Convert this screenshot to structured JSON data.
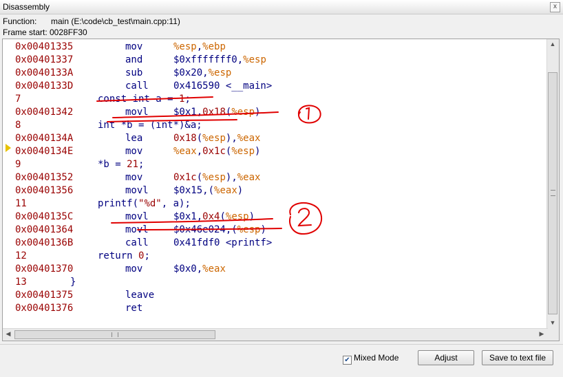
{
  "window": {
    "title": "Disassembly",
    "close_glyph": "x"
  },
  "info": {
    "function_label": "Function:",
    "function_value": "main (E:\\code\\cb_test\\main.cpp:11)",
    "frame_label": "Frame start: 0028FF30"
  },
  "lines": [
    {
      "kind": "asm",
      "addr": "0x00401335",
      "mnem": "mov",
      "ops": [
        [
          "%esp",
          "reg"
        ],
        [
          ",",
          "op"
        ],
        [
          "%ebp",
          "reg"
        ]
      ]
    },
    {
      "kind": "asm",
      "addr": "0x00401337",
      "mnem": "and",
      "ops": [
        [
          "$0xfffffff0",
          "op"
        ],
        [
          ",",
          "op"
        ],
        [
          "%esp",
          "reg"
        ]
      ]
    },
    {
      "kind": "asm",
      "addr": "0x0040133A",
      "mnem": "sub",
      "ops": [
        [
          "$0x20",
          "op"
        ],
        [
          ",",
          "op"
        ],
        [
          "%esp",
          "reg"
        ]
      ]
    },
    {
      "kind": "asm",
      "addr": "0x0040133D",
      "mnem": "call",
      "ops": [
        [
          "0x416590 <__main>",
          "op"
        ]
      ]
    },
    {
      "kind": "src",
      "num": "7",
      "parts": [
        [
          "const int a = ",
          "op"
        ],
        [
          "1",
          "num"
        ],
        [
          ";",
          "op"
        ]
      ]
    },
    {
      "kind": "asm",
      "addr": "0x00401342",
      "mnem": "movl",
      "ops": [
        [
          "$0x1",
          "op"
        ],
        [
          ",",
          "op"
        ],
        [
          "0x18",
          "num"
        ],
        [
          "(",
          "op"
        ],
        [
          "%esp",
          "reg"
        ],
        [
          ")",
          "op"
        ]
      ]
    },
    {
      "kind": "src",
      "num": "8",
      "parts": [
        [
          "int *b = (int*)&a;",
          "op"
        ]
      ]
    },
    {
      "kind": "asm",
      "addr": "0x0040134A",
      "mnem": "lea",
      "ops": [
        [
          "0x18",
          "num"
        ],
        [
          "(",
          "op"
        ],
        [
          "%esp",
          "reg"
        ],
        [
          ")",
          "op"
        ],
        [
          ",",
          "op"
        ],
        [
          "%eax",
          "reg"
        ]
      ]
    },
    {
      "kind": "asm",
      "addr": "0x0040134E",
      "mnem": "mov",
      "ops": [
        [
          "%eax",
          "reg"
        ],
        [
          ",",
          "op"
        ],
        [
          "0x1c",
          "num"
        ],
        [
          "(",
          "op"
        ],
        [
          "%esp",
          "reg"
        ],
        [
          ")",
          "op"
        ]
      ]
    },
    {
      "kind": "src",
      "num": "9",
      "parts": [
        [
          "*b = ",
          "op"
        ],
        [
          "21",
          "num"
        ],
        [
          ";",
          "op"
        ]
      ]
    },
    {
      "kind": "asm",
      "addr": "0x00401352",
      "mnem": "mov",
      "ops": [
        [
          "0x1c",
          "num"
        ],
        [
          "(",
          "op"
        ],
        [
          "%esp",
          "reg"
        ],
        [
          ")",
          "op"
        ],
        [
          ",",
          "op"
        ],
        [
          "%eax",
          "reg"
        ]
      ]
    },
    {
      "kind": "asm",
      "addr": "0x00401356",
      "mnem": "movl",
      "ops": [
        [
          "$0x15",
          "op"
        ],
        [
          ",",
          "op"
        ],
        [
          "(",
          "op"
        ],
        [
          "%eax",
          "reg"
        ],
        [
          ")",
          "op"
        ]
      ]
    },
    {
      "kind": "src",
      "num": "11",
      "parts": [
        [
          "printf(",
          "op"
        ],
        [
          "\"%d\"",
          "num"
        ],
        [
          ", a);",
          "op"
        ]
      ]
    },
    {
      "kind": "asm",
      "addr": "0x0040135C",
      "mnem": "movl",
      "ops": [
        [
          "$0x1",
          "op"
        ],
        [
          ",",
          "op"
        ],
        [
          "0x4",
          "num"
        ],
        [
          "(",
          "op"
        ],
        [
          "%esp",
          "reg"
        ],
        [
          ")",
          "op"
        ]
      ]
    },
    {
      "kind": "asm",
      "addr": "0x00401364",
      "mnem": "movl",
      "ops": [
        [
          "$0x46e024",
          "op"
        ],
        [
          ",",
          "op"
        ],
        [
          "(",
          "op"
        ],
        [
          "%esp",
          "reg"
        ],
        [
          ")",
          "op"
        ]
      ]
    },
    {
      "kind": "asm",
      "addr": "0x0040136B",
      "mnem": "call",
      "ops": [
        [
          "0x41fdf0 <printf>",
          "op"
        ]
      ]
    },
    {
      "kind": "src",
      "num": "12",
      "parts": [
        [
          "return ",
          "op"
        ],
        [
          "0",
          "num"
        ],
        [
          ";",
          "op"
        ]
      ]
    },
    {
      "kind": "asm",
      "addr": "0x00401370",
      "mnem": "mov",
      "ops": [
        [
          "$0x0",
          "op"
        ],
        [
          ",",
          "op"
        ],
        [
          "%eax",
          "reg"
        ]
      ]
    },
    {
      "kind": "src",
      "num": "13",
      "parts": [
        [
          "}",
          "op"
        ]
      ],
      "brace": true
    },
    {
      "kind": "asm",
      "addr": "0x00401375",
      "mnem": "leave",
      "ops": []
    },
    {
      "kind": "asm",
      "addr": "0x00401376",
      "mnem": "ret",
      "ops": []
    }
  ],
  "annotations": {
    "mark1": "1",
    "mark2": "2"
  },
  "bottom": {
    "mixed_mode_label": "Mixed Mode",
    "mixed_mode_checked": true,
    "adjust_label": "Adjust",
    "save_label": "Save to text file"
  },
  "colors": {
    "address": "#990000",
    "code": "#000080",
    "register": "#cc6600",
    "annotation": "#e00000",
    "current_line_marker": "#e8c200"
  }
}
